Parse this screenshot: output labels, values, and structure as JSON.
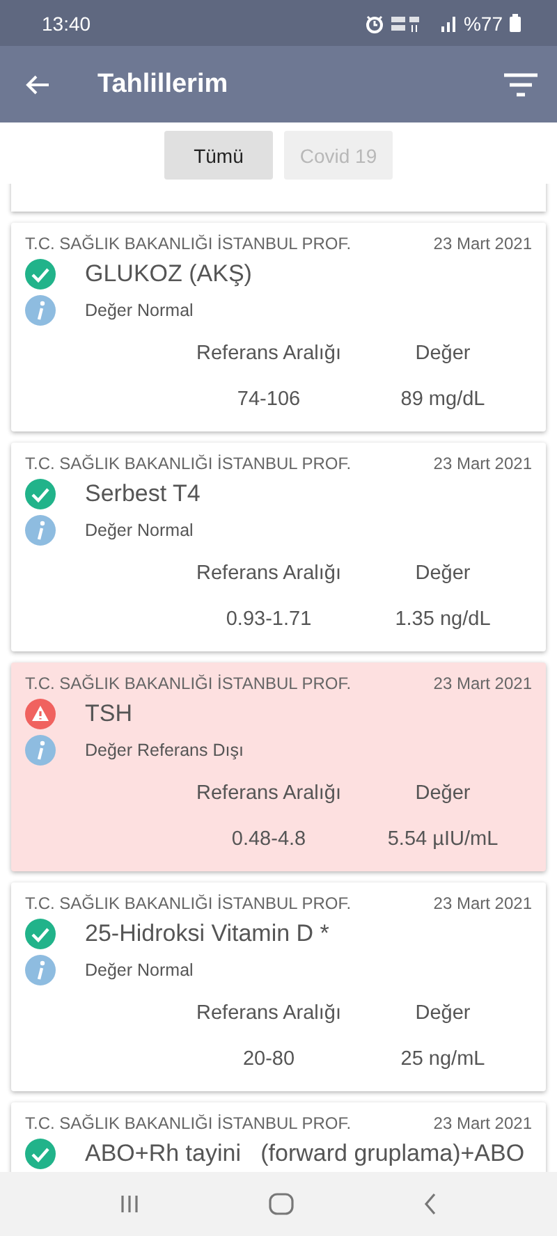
{
  "status_bar": {
    "time": "13:40",
    "battery": "%77"
  },
  "app_bar": {
    "title": "Tahlillerim"
  },
  "filters": [
    {
      "label": "Tümü",
      "selected": true
    },
    {
      "label": "Covid 19",
      "selected": false
    }
  ],
  "results": [
    {
      "institution": "T.C. SAĞLIK BAKANLIĞI  İSTANBUL PROF.",
      "date": "23 Mart 2021",
      "title": "GLUKOZ (AKŞ)",
      "kind": "normal",
      "status_text": "Değer Normal",
      "range_label": "Referans Aralığı",
      "value_label": "Değer",
      "range": "74-106",
      "value": "89 mg/dL"
    },
    {
      "institution": "T.C. SAĞLIK BAKANLIĞI  İSTANBUL PROF.",
      "date": "23 Mart 2021",
      "title": "Serbest T4",
      "kind": "normal",
      "status_text": "Değer Normal",
      "range_label": "Referans Aralığı",
      "value_label": "Değer",
      "range": "0.93-1.71",
      "value": "1.35 ng/dL"
    },
    {
      "institution": "T.C. SAĞLIK BAKANLIĞI  İSTANBUL PROF.",
      "date": "23 Mart 2021",
      "title": "TSH",
      "kind": "abnormal",
      "status_text": "Değer Referans Dışı",
      "range_label": "Referans Aralığı",
      "value_label": "Değer",
      "range": "0.48-4.8",
      "value": "5.54 µIU/mL"
    },
    {
      "institution": "T.C. SAĞLIK BAKANLIĞI  İSTANBUL PROF.",
      "date": "23 Mart 2021",
      "title": "25-Hidroksi Vitamin D *",
      "kind": "normal",
      "status_text": "Değer Normal",
      "range_label": "Referans Aralığı",
      "value_label": "Değer",
      "range": "20-80",
      "value": "25 ng/mL"
    },
    {
      "institution": "T.C. SAĞLIK BAKANLIĞI  İSTANBUL PROF.",
      "date": "23 Mart 2021",
      "title": "ABO+Rh tayini   (forward gruplama)+ABO",
      "kind": "normal"
    }
  ]
}
